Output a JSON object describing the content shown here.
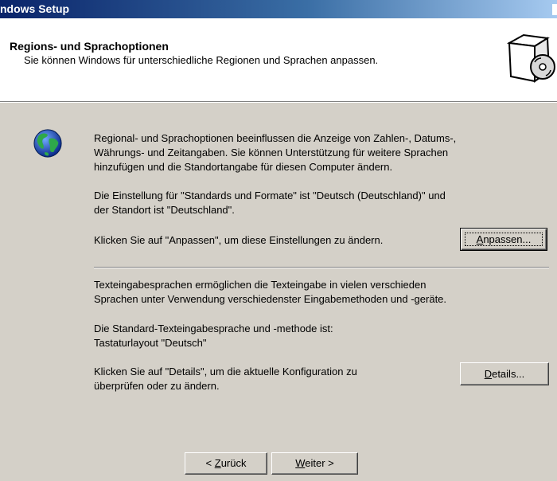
{
  "window": {
    "title": "ndows Setup"
  },
  "header": {
    "title": "Regions- und Sprachoptionen",
    "subtitle": "Sie können Windows für unterschiedliche Regionen und Sprachen anpassen.",
    "icon": "setup-box-cd-icon"
  },
  "regional": {
    "icon": "globe-icon",
    "description_lines": [
      "Regional- und Sprachoptionen beeinflussen die Anzeige von Zahlen-, Datums-,",
      "Währungs- und Zeitangaben. Sie können Unterstützung für weitere Sprachen",
      "hinzufügen und die Standortangabe für diesen Computer ändern."
    ],
    "current_lines": [
      "Die Einstellung für \"Standards und Formate\" ist \"Deutsch (Deutschland)\" und",
      "der Standort ist \"Deutschland\"."
    ],
    "customize_prompt": "Klicken Sie auf \"Anpassen\", um diese Einstellungen zu ändern.",
    "customize_button": {
      "accel": "A",
      "rest": "npassen..."
    }
  },
  "input": {
    "description_lines": [
      "Texteingabesprachen ermöglichen die Texteingabe in vielen verschieden",
      "Sprachen unter Verwendung verschiedenster Eingabemethoden und -geräte."
    ],
    "current_lines": [
      "Die Standard-Texteingabesprache und -methode ist:",
      "Tastaturlayout \"Deutsch\""
    ],
    "details_prompt_lines": [
      "Klicken Sie auf \"Details\", um die aktuelle Konfiguration zu",
      "überprüfen oder zu ändern."
    ],
    "details_button": {
      "accel": "D",
      "rest": "etails..."
    }
  },
  "navigation": {
    "back_button": {
      "before": "< ",
      "accel": "Z",
      "rest": "urück"
    },
    "next_button": {
      "accel": "W",
      "rest": "eiter >"
    }
  }
}
